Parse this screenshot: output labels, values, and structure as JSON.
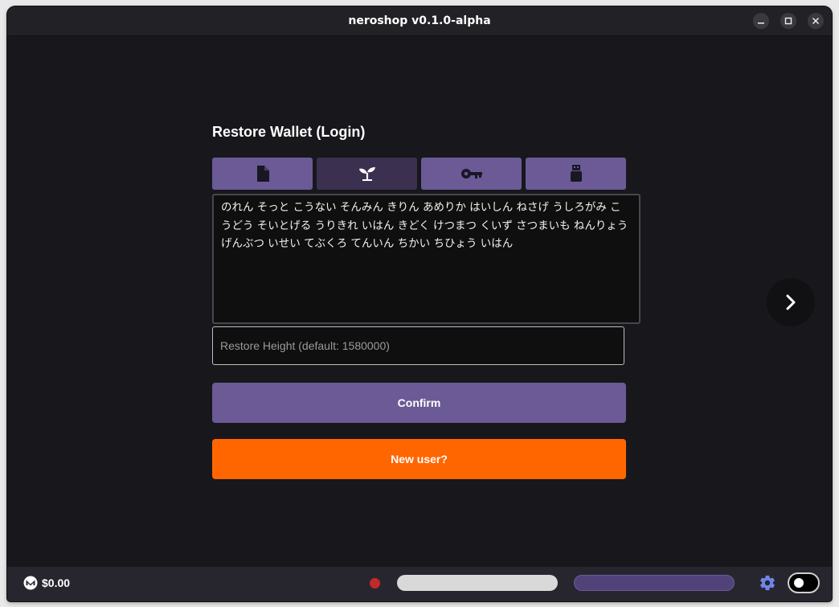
{
  "window": {
    "title": "neroshop v0.1.0-alpha",
    "minimize_icon": "minimize-icon",
    "maximize_icon": "maximize-icon",
    "close_icon": "close-icon"
  },
  "restore": {
    "heading": "Restore Wallet (Login)",
    "tabs": [
      {
        "icon": "file-icon",
        "active": false
      },
      {
        "icon": "sprout-icon",
        "active": true
      },
      {
        "icon": "key-icon",
        "active": false
      },
      {
        "icon": "usb-drive-icon",
        "active": false
      }
    ],
    "seed_text": "のれん そっと こうない そんみん きりん あめりか はいしん ねさげ うしろがみ こうどう そいとげる うりきれ いはん きどく けつまつ くいず さつまいも ねんりょう げんぶつ いせい てぶくろ てんいん ちかい ちひょう いはん",
    "restore_height_placeholder": "Restore Height (default: 1580000)",
    "confirm_label": "Confirm",
    "new_user_label": "New user?"
  },
  "footer": {
    "balance": "$0.00",
    "currency_icon": "monero-icon",
    "status_color": "#c62828",
    "settings_icon": "gear-icon",
    "theme_toggle_icon": "toggle-icon"
  },
  "colors": {
    "accent": "#6b5a96",
    "accent_dark": "#3b3050",
    "orange": "#ff6600",
    "background": "#18171c"
  }
}
